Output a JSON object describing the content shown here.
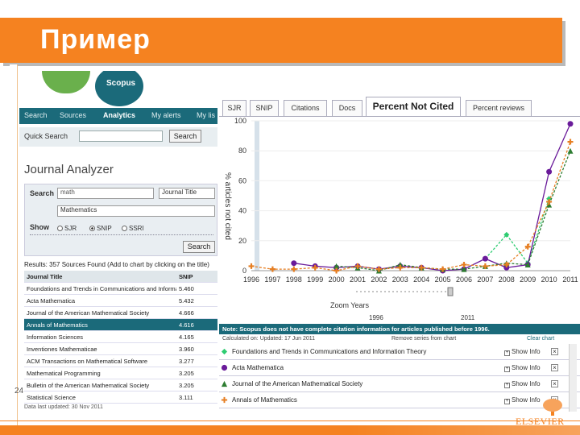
{
  "slide": {
    "title": "Пример",
    "page_number": "24",
    "brand": "ELSEVIER",
    "accent_color": "#f58220"
  },
  "scopus": {
    "logo_text": "Scopus",
    "nav": [
      "Search",
      "Sources",
      "Analytics",
      "My alerts",
      "My lis"
    ],
    "nav_active": "Analytics",
    "quick_search_label": "Quick Search",
    "search_button": "Search",
    "page_title": "Journal Analyzer",
    "form": {
      "search_label": "Search",
      "search_value": "math",
      "search_type": "Journal Title",
      "subject_value": "Mathematics",
      "show_label": "Show",
      "options": [
        "SJR",
        "SNIP",
        "SSRI"
      ],
      "selected_option": "SNIP",
      "button": "Search"
    },
    "results_text": "Results: 357 Sources Found (Add to chart by clicking on the title)",
    "table": {
      "headers": [
        "Journal Title",
        "SNIP"
      ],
      "rows": [
        {
          "title": "Foundations and Trends in Communications and Information Theory",
          "value": "5.460"
        },
        {
          "title": "Acta Mathematica",
          "value": "5.432"
        },
        {
          "title": "Journal of the American Mathematical Society",
          "value": "4.666"
        },
        {
          "title": "Annals of Mathematics",
          "value": "4.616"
        },
        {
          "title": "Information Sciences",
          "value": "4.165"
        },
        {
          "title": "Inventiones Mathematicae",
          "value": "3.960"
        },
        {
          "title": "ACM Transactions on Mathematical Software",
          "value": "3.277"
        },
        {
          "title": "Mathematical Programming",
          "value": "3.205"
        },
        {
          "title": "Bulletin of the American Mathematical Society",
          "value": "3.205"
        },
        {
          "title": "Statistical Science",
          "value": "3.111"
        }
      ],
      "selected_index": 3
    },
    "updated": "Data last updated: 30 Nov 2011"
  },
  "chart_panel": {
    "tabs": [
      "SJR",
      "SNIP",
      "Citations",
      "Docs",
      "Percent Not Cited",
      "Percent reviews"
    ],
    "active_tab": "Percent Not Cited",
    "zoom_label": "Zoom Years",
    "zoom_from": "1996",
    "zoom_to": "2011"
  },
  "chart_data": {
    "type": "line",
    "title": "",
    "xlabel": "",
    "ylabel": "% articles not cited",
    "x": [
      "1996",
      "1997",
      "1998",
      "1999",
      "2000",
      "2001",
      "2002",
      "2003",
      "2004",
      "2005",
      "2006",
      "2007",
      "2008",
      "2009",
      "2010",
      "2011"
    ],
    "yticks": [
      0,
      20,
      40,
      60,
      80,
      100
    ],
    "ylim": [
      0,
      100
    ],
    "series": [
      {
        "name": "Foundations and Trends in Communications and Information Theory",
        "color": "#2ecc71",
        "marker": "diamond",
        "values": [
          null,
          null,
          null,
          null,
          null,
          null,
          null,
          null,
          null,
          null,
          null,
          8,
          24,
          5,
          48,
          null
        ]
      },
      {
        "name": "Acta Mathematica",
        "color": "#6a1b9a",
        "marker": "circle",
        "values": [
          null,
          null,
          5,
          3,
          2,
          3,
          1,
          3,
          2,
          0,
          1,
          8,
          2,
          4,
          66,
          98
        ]
      },
      {
        "name": "Journal of the American Mathematical Society",
        "color": "#2e7d32",
        "marker": "triangle",
        "values": [
          null,
          null,
          null,
          null,
          3,
          2,
          0,
          4,
          2,
          1,
          1,
          3,
          5,
          4,
          44,
          80
        ]
      },
      {
        "name": "Annals of Mathematics",
        "color": "#e67e22",
        "marker": "plus",
        "values": [
          3,
          1,
          1,
          2,
          0,
          3,
          1,
          2,
          2,
          1,
          4,
          3,
          4,
          16,
          46,
          86
        ]
      }
    ],
    "note": "Note: Scopus does not have complete citation information for articles published before 1996.",
    "calculated": "Calculated on: Updated: 17 Jun 2011"
  },
  "legend_panel": {
    "header": "Remove series from chart",
    "clear_chart": "Clear chart",
    "show_info": "Show Info"
  }
}
